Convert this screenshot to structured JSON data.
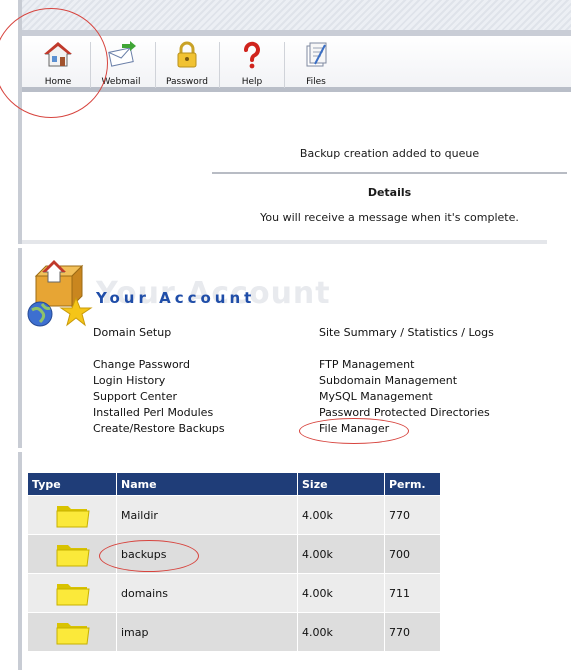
{
  "toolbar": {
    "buttons": [
      {
        "label": "Home",
        "icon": "home-icon"
      },
      {
        "label": "Webmail",
        "icon": "webmail-icon"
      },
      {
        "label": "Password",
        "icon": "padlock-icon"
      },
      {
        "label": "Help",
        "icon": "question-mark-icon"
      },
      {
        "label": "Files",
        "icon": "files-icon"
      }
    ]
  },
  "status": {
    "message": "Backup creation added to queue",
    "details_heading": "Details",
    "details_text": "You will receive a message when it's complete."
  },
  "account": {
    "title": "Your Account",
    "watermark": "Your Account",
    "left_links": [
      "Domain Setup",
      "Change Password",
      "Login History",
      "Support Center",
      "Installed Perl Modules",
      "Create/Restore Backups"
    ],
    "right_links": [
      "Site Summary / Statistics / Logs",
      "FTP Management",
      "Subdomain Management",
      "MySQL Management",
      "Password Protected Directories",
      "File Manager"
    ]
  },
  "files": {
    "headers": [
      "Type",
      "Name",
      "Size",
      "Perm."
    ],
    "rows": [
      {
        "name": "Maildir",
        "size": "4.00k",
        "perm": "770"
      },
      {
        "name": "backups",
        "size": "4.00k",
        "perm": "700"
      },
      {
        "name": "domains",
        "size": "4.00k",
        "perm": "711"
      },
      {
        "name": "imap",
        "size": "4.00k",
        "perm": "770"
      }
    ]
  },
  "colors": {
    "header_bg": "#1f3d78",
    "title_blue": "#1f4da8",
    "annotation_red": "#d7443e"
  }
}
